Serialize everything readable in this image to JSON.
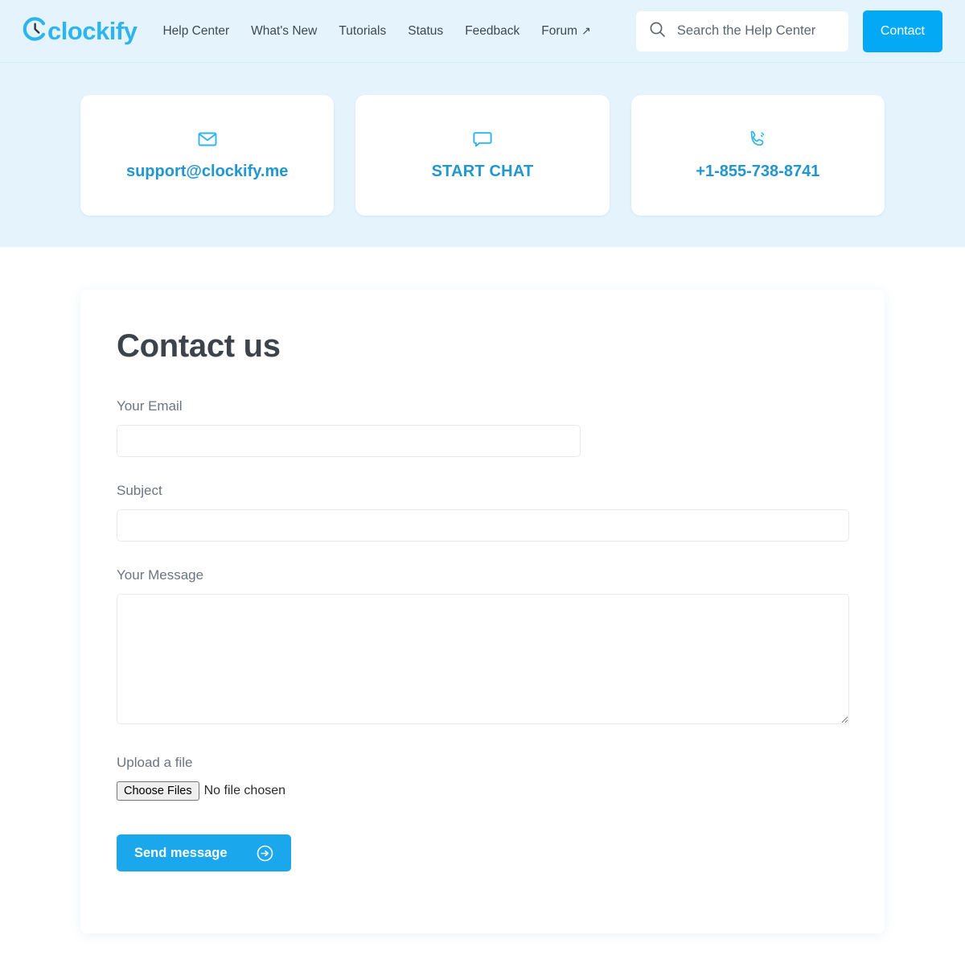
{
  "header": {
    "logo_text": "clockify",
    "logo_icon": "clockify-clock-logo-icon",
    "nav": [
      {
        "label": "Help Center",
        "icon": null
      },
      {
        "label": "What's New",
        "icon": null
      },
      {
        "label": "Tutorials",
        "icon": null
      },
      {
        "label": "Status",
        "icon": null
      },
      {
        "label": "Feedback",
        "icon": null
      },
      {
        "label": "Forum",
        "icon": "external-link-arrow-icon",
        "arrow": "↗"
      }
    ],
    "search": {
      "icon": "search-icon",
      "placeholder": "Search the Help Center",
      "value": ""
    },
    "contact_button": "Contact"
  },
  "hero": {
    "cards": [
      {
        "icon": "envelope-icon",
        "label": "support@clockify.me",
        "style": "email"
      },
      {
        "icon": "chat-bubble-icon",
        "label": "START CHAT",
        "style": "chat"
      },
      {
        "icon": "phone-ringing-icon",
        "label": "+1-855-738-8741",
        "style": "phone"
      }
    ]
  },
  "form": {
    "title": "Contact us",
    "email": {
      "label": "Your Email",
      "value": "",
      "placeholder": ""
    },
    "subject": {
      "label": "Subject",
      "value": "",
      "placeholder": ""
    },
    "message": {
      "label": "Your Message",
      "value": "",
      "placeholder": ""
    },
    "upload": {
      "label": "Upload a file",
      "button_label": "Choose Files",
      "status": "No file chosen"
    },
    "submit": {
      "label": "Send message",
      "icon": "arrow-right-circle-icon"
    }
  },
  "colors": {
    "brand_blue": "#03a9f4",
    "logo_blue": "#2fb5ee",
    "hero_bg": "#e4f3fc",
    "link_blue": "#2196cf",
    "title_gray": "#3c434b",
    "label_gray": "#6b7580",
    "page_bg": "#ffffff"
  }
}
